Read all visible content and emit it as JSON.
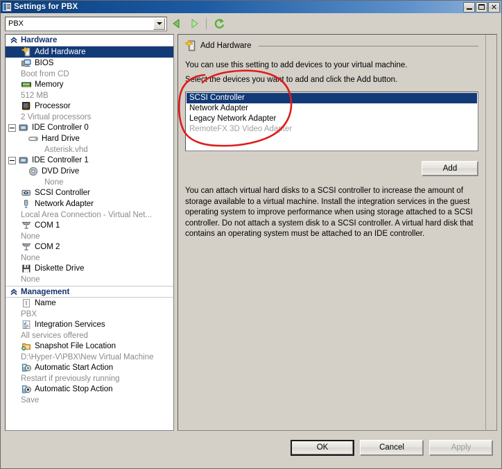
{
  "window": {
    "title": "Settings for PBX",
    "icon": "settings-vm-icon",
    "buttons": {
      "minimize": "_",
      "maximize": "□",
      "close": "✕"
    }
  },
  "toolbar": {
    "vm_selector_value": "PBX",
    "vm_selector_placeholder": "PBX",
    "back_label": "Back",
    "forward_label": "Forward",
    "refresh_label": "Refresh"
  },
  "sidebar": {
    "sections": [
      {
        "name": "Hardware",
        "title": "Hardware",
        "items": [
          {
            "label": "Add Hardware",
            "sub": "",
            "icon": "add-hardware-icon",
            "indent": 0,
            "expander": "none",
            "selected": true
          },
          {
            "label": "BIOS",
            "sub": "Boot from CD",
            "icon": "bios-icon",
            "indent": 0,
            "expander": "none",
            "selected": false
          },
          {
            "label": "Memory",
            "sub": "512 MB",
            "icon": "memory-icon",
            "indent": 0,
            "expander": "none",
            "selected": false
          },
          {
            "label": "Processor",
            "sub": "2 Virtual processors",
            "icon": "processor-icon",
            "indent": 0,
            "expander": "none",
            "selected": false
          },
          {
            "label": "IDE Controller 0",
            "sub": "",
            "icon": "ide-controller-icon",
            "indent": -1,
            "expander": "minus",
            "selected": false
          },
          {
            "label": "Hard Drive",
            "sub": "Asterisk.vhd",
            "icon": "hard-drive-icon",
            "indent": 1,
            "expander": "none",
            "selected": false
          },
          {
            "label": "IDE Controller 1",
            "sub": "",
            "icon": "ide-controller-icon",
            "indent": -1,
            "expander": "minus",
            "selected": false
          },
          {
            "label": "DVD Drive",
            "sub": "None",
            "icon": "dvd-drive-icon",
            "indent": 1,
            "expander": "none",
            "selected": false
          },
          {
            "label": "SCSI Controller",
            "sub": "",
            "icon": "scsi-controller-icon",
            "indent": 0,
            "expander": "none",
            "selected": false
          },
          {
            "label": "Network Adapter",
            "sub": "Local Area Connection - Virtual Net...",
            "icon": "network-adapter-icon",
            "indent": 0,
            "expander": "none",
            "selected": false
          },
          {
            "label": "COM 1",
            "sub": "None",
            "icon": "com-port-icon",
            "indent": 0,
            "expander": "none",
            "selected": false
          },
          {
            "label": "COM 2",
            "sub": "None",
            "icon": "com-port-icon",
            "indent": 0,
            "expander": "none",
            "selected": false
          },
          {
            "label": "Diskette Drive",
            "sub": "None",
            "icon": "diskette-drive-icon",
            "indent": 0,
            "expander": "none",
            "selected": false
          }
        ]
      },
      {
        "name": "Management",
        "title": "Management",
        "items": [
          {
            "label": "Name",
            "sub": "PBX",
            "icon": "name-icon",
            "indent": 0,
            "expander": "none",
            "selected": false
          },
          {
            "label": "Integration Services",
            "sub": "All services offered",
            "icon": "integration-services-icon",
            "indent": 0,
            "expander": "none",
            "selected": false
          },
          {
            "label": "Snapshot File Location",
            "sub": "D:\\Hyper-V\\PBX\\New Virtual Machine",
            "icon": "snapshot-folder-icon",
            "indent": 0,
            "expander": "none",
            "selected": false
          },
          {
            "label": "Automatic Start Action",
            "sub": "Restart if previously running",
            "icon": "auto-start-icon",
            "indent": 0,
            "expander": "none",
            "selected": false
          },
          {
            "label": "Automatic Stop Action",
            "sub": "Save",
            "icon": "auto-stop-icon",
            "indent": 0,
            "expander": "none",
            "selected": false
          }
        ]
      }
    ]
  },
  "main": {
    "panel_title": "Add Hardware",
    "panel_icon": "add-hardware-icon",
    "intro_line_1": "You can use this setting to add devices to your virtual machine.",
    "intro_line_2": "Select the devices you want to add and click the Add button.",
    "device_list": [
      {
        "label": "SCSI Controller",
        "state": "selected"
      },
      {
        "label": "Network Adapter",
        "state": "normal"
      },
      {
        "label": "Legacy Network Adapter",
        "state": "normal"
      },
      {
        "label": "RemoteFX 3D Video Adapter",
        "state": "disabled"
      }
    ],
    "add_button": "Add",
    "description": "You can attach virtual hard disks to a SCSI controller to increase the amount of storage available to a virtual machine. Install the integration services in the guest operating system to improve performance when using storage attached to a SCSI controller. Do not attach a system disk to a SCSI controller. A virtual hard disk that contains an operating system must be attached to an IDE controller."
  },
  "footer": {
    "ok": "OK",
    "cancel": "Cancel",
    "apply": "Apply",
    "apply_disabled": true
  },
  "annotation": {
    "type": "hand-drawn-circle",
    "color": "#e01b1b",
    "target": "device-list"
  },
  "colors": {
    "titlebar_start": "#0b3f80",
    "titlebar_end": "#8fb2d8",
    "window_face": "#d4d0c8",
    "selection": "#123a77",
    "section_header_text": "#16326b",
    "sub_text": "#8a8a8a",
    "annotation_red": "#e01b1b",
    "toolbar_green": "#5cb63c"
  }
}
